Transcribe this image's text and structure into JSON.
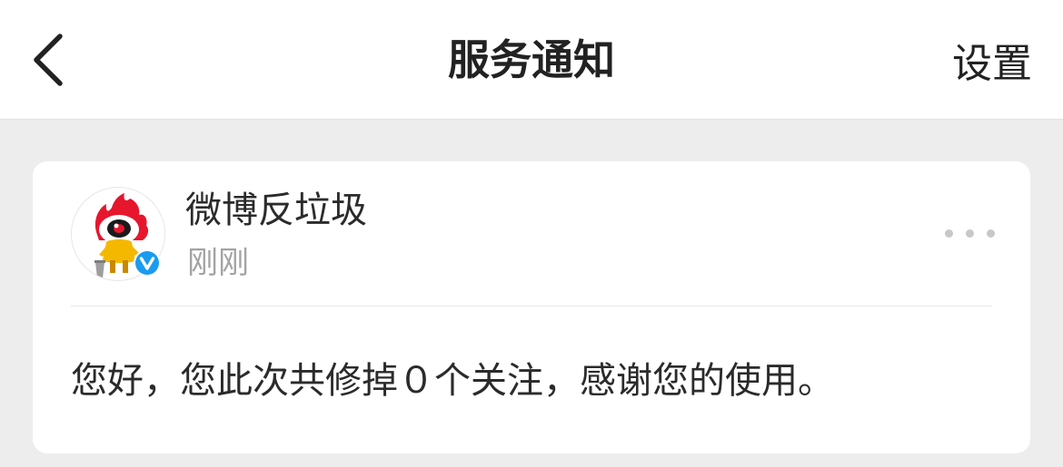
{
  "header": {
    "back_icon": "chevron-left-icon",
    "title": "服务通知",
    "settings_label": "设置"
  },
  "notification": {
    "sender_name": "微博反垃圾",
    "time": "刚刚",
    "avatar_icon": "weibo-mascot-avatar",
    "verified_icon": "verified-v-badge-icon",
    "more_icon": "more-dots-icon",
    "message": "您好，您此次共修掉０个关注，感谢您的使用。"
  },
  "colors": {
    "background": "#ededed",
    "card": "#ffffff",
    "text_primary": "#222222",
    "text_secondary": "#a3a3a3",
    "verified_blue": "#1a9bf0",
    "weibo_red": "#e6162d",
    "weibo_yellow": "#f5b800"
  }
}
